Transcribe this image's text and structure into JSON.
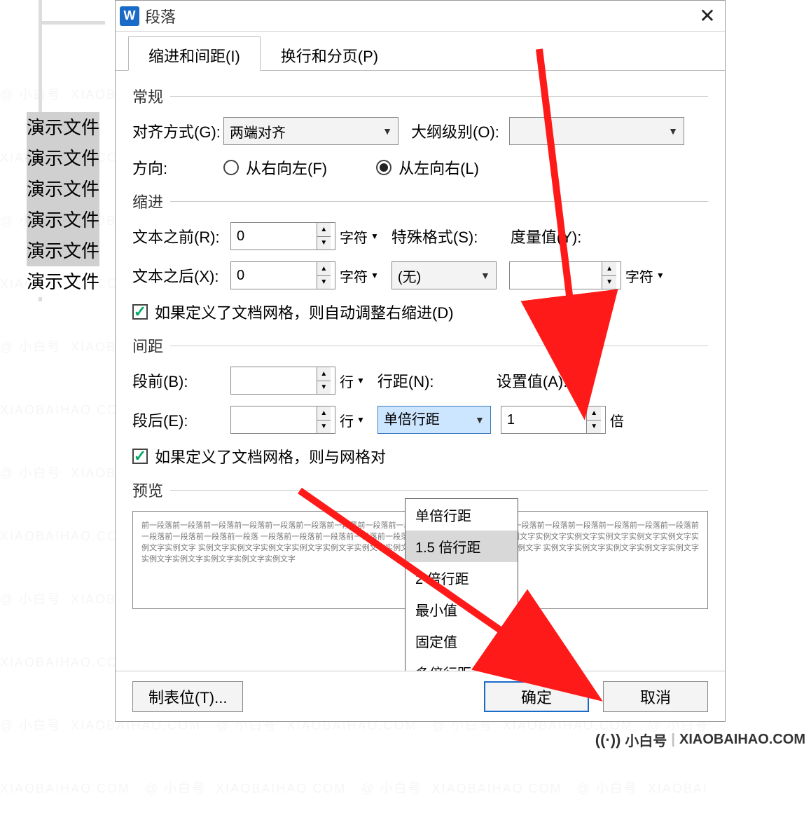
{
  "watermark": {
    "text": "@ 小白号  XIAOBAIHAO.COM "
  },
  "doc": {
    "selected_line": "演示文件",
    "repeat": 6
  },
  "dialog": {
    "icon": "W",
    "title": "段落",
    "close": "✕",
    "tabs": {
      "indent": "缩进和间距(I)",
      "pagination": "换行和分页(P)",
      "active": 0
    },
    "sections": {
      "general": "常规",
      "indent": "缩进",
      "spacing": "间距",
      "preview": "预览"
    },
    "general": {
      "align_label": "对齐方式(G):",
      "align_value": "两端对齐",
      "outline_label": "大纲级别(O):",
      "outline_value": "",
      "direction_label": "方向:",
      "rtl": "从右向左(F)",
      "ltr": "从左向右(L)",
      "ltr_checked": true
    },
    "indent": {
      "before_label": "文本之前(R):",
      "before_value": "0",
      "after_label": "文本之后(X):",
      "after_value": "0",
      "unit": "字符",
      "special_label": "特殊格式(S):",
      "special_value": "(无)",
      "measure_label": "度量值(Y):",
      "measure_value": "",
      "measure_unit": "字符",
      "auto_indent": "如果定义了文档网格，则自动调整右缩进(D)"
    },
    "spacing": {
      "before_label": "段前(B):",
      "before_value": "",
      "after_label": "段后(E):",
      "after_value": "",
      "unit": "行",
      "line_label": "行距(N):",
      "line_value": "单倍行距",
      "set_label": "设置值(A):",
      "set_value": "1",
      "set_unit": "倍",
      "snap": "如果定义了文档网格，则与网格对",
      "options": [
        "单倍行距",
        "1.5 倍行距",
        "2 倍行距",
        "最小值",
        "固定值",
        "多倍行距"
      ],
      "hover_index": 1
    },
    "preview_text": "前一段落前一段落前一段落前一段落前一段落前一段落前一段落前一段落前一段落前一段落前一段落\n一段落前一段落前一段落前一段落前一段落前一段落前一段落前一段落前一段落前一段落前一段落\n一段落前一段落前一段落前一段落前一段落\n实例文字实例文字实例文字实例文字实例文字实例文字实例文字实例文字实例文字实例文字实例文字\n实例文字实例文字实例文字实例文字实例文字实例文字实例文字实例文字实例文字实例文字实例文字\n实例文字实例文字实例文字实例文字实例文字实例文字实例文字实例文字实例文字实例文字",
    "footer": {
      "tabs": "制表位(T)...",
      "ok": "确定",
      "cancel": "取消"
    }
  },
  "credit": {
    "icon": "((·))",
    "text": "小白号",
    "url": "XIAOBAIHAO.COM"
  }
}
